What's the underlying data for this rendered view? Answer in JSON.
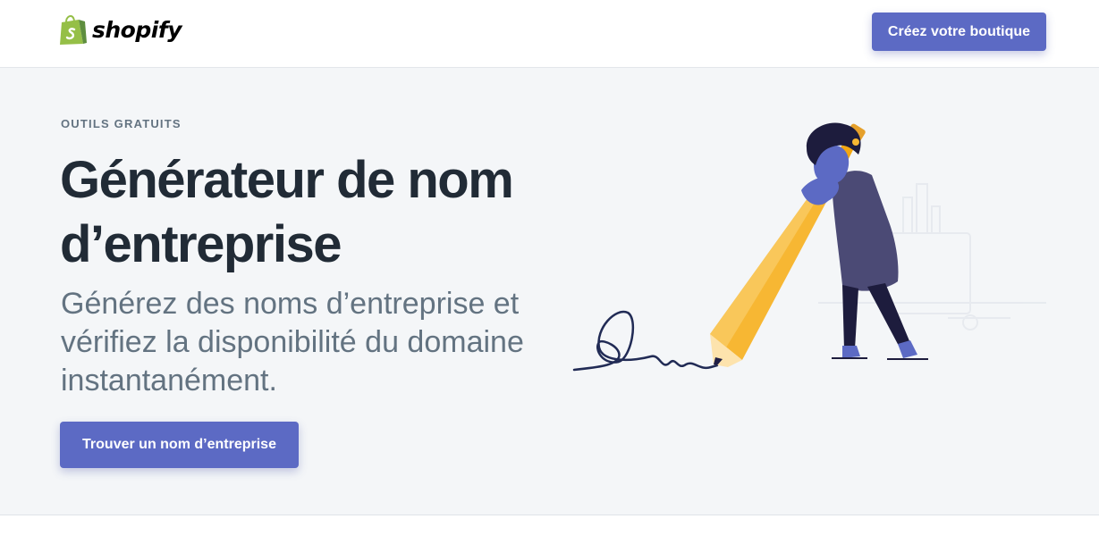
{
  "header": {
    "logo_text": "shopify",
    "cta_label": "Créez votre boutique"
  },
  "hero": {
    "eyebrow": "OUTILS GRATUITS",
    "title": "Générateur de nom d’entreprise",
    "subtitle": "Générez des noms d’entreprise et vérifiez la disponibilité du domaine instantanément.",
    "cta_label": "Trouver un nom d’entreprise",
    "illustration": "person-writing-with-giant-pencil"
  },
  "colors": {
    "accent": "#5c6ac4",
    "hero_background": "#f4f6f8",
    "heading": "#212b36",
    "muted_text": "#637381",
    "logo_green": "#95bf47",
    "pencil_yellow": "#f7b733",
    "figure_purple": "#5c6ac4"
  }
}
